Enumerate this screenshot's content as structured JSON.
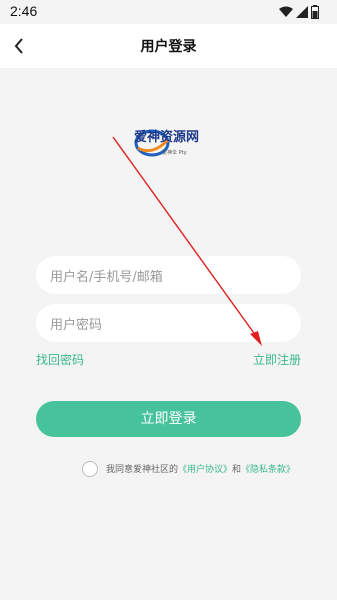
{
  "status": {
    "time": "2:46"
  },
  "header": {
    "title": "用户登录"
  },
  "logo": {
    "main": "爱神资源网",
    "sub": "爱神伞 Pty"
  },
  "form": {
    "username_placeholder": "用户名/手机号/邮箱",
    "password_placeholder": "用户密码"
  },
  "links": {
    "forgot": "找回密码",
    "register": "立即注册"
  },
  "login_button": "立即登录",
  "agreement": {
    "prefix": "我同意爱神社区的",
    "user_agreement": "《用户协议》",
    "and": "和",
    "privacy": "《隐私条款》"
  },
  "colors": {
    "accent": "#46c39b",
    "annotation_arrow": "#e02020"
  }
}
